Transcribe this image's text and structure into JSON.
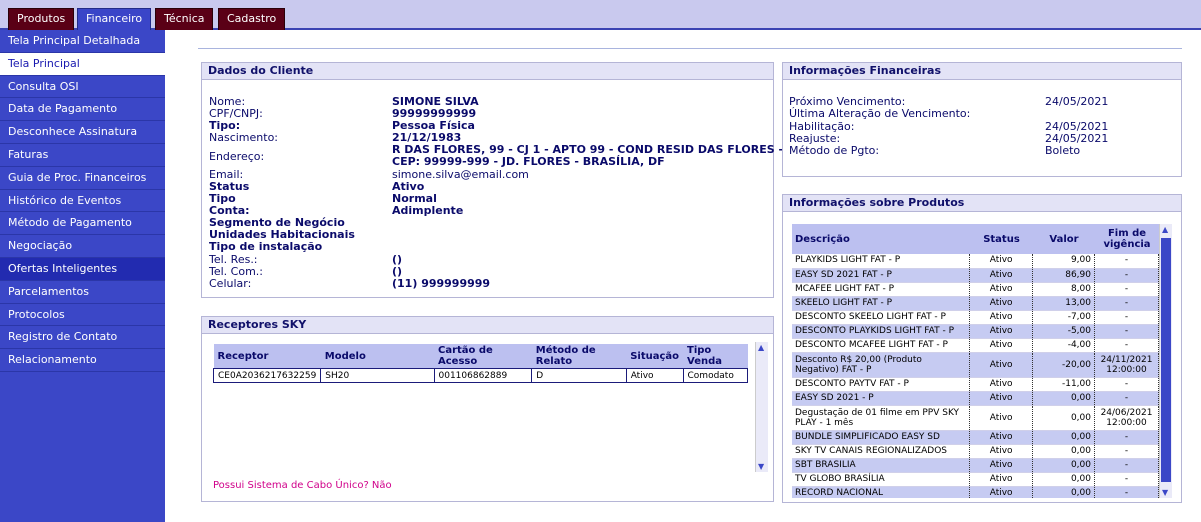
{
  "top_tabs": [
    {
      "label": "Produtos"
    },
    {
      "label": "Financeiro"
    },
    {
      "label": "Técnica"
    },
    {
      "label": "Cadastro"
    }
  ],
  "sidebar": {
    "items": [
      {
        "label": "Tela Principal Detalhada"
      },
      {
        "label": "Tela Principal"
      },
      {
        "label": "Consulta OSI"
      },
      {
        "label": "Data de Pagamento"
      },
      {
        "label": "Desconhece Assinatura"
      },
      {
        "label": "Faturas"
      },
      {
        "label": "Guia de Proc. Financeiros"
      },
      {
        "label": "Histórico de Eventos"
      },
      {
        "label": "Método de Pagamento"
      },
      {
        "label": "Negociação"
      },
      {
        "label": "Ofertas Inteligentes"
      },
      {
        "label": "Parcelamentos"
      },
      {
        "label": "Protocolos"
      },
      {
        "label": "Registro de Contato"
      },
      {
        "label": "Relacionamento"
      }
    ]
  },
  "cliente": {
    "title": "Dados do Cliente",
    "rows": [
      {
        "label": "Nome:",
        "value": "SIMONE SILVA"
      },
      {
        "label": "CPF/CNPJ:",
        "value": "99999999999"
      },
      {
        "label": "Tipo:",
        "value": "Pessoa Física"
      },
      {
        "label": "Nascimento:",
        "value": "21/12/1983"
      },
      {
        "label": "Endereço:",
        "value": "R DAS FLORES, 99 - CJ 1 - APTO 99 - COND RESID DAS FLORES -",
        "value2": "CEP: 99999-999 - JD. FLORES - BRASÍLIA, DF"
      },
      {
        "label": "Email:",
        "value": "simone.silva@email.com"
      },
      {
        "label": "Status",
        "value": "Ativo"
      },
      {
        "label": "Tipo",
        "value": "Normal"
      },
      {
        "label": "Conta:",
        "value": "Adimplente"
      },
      {
        "label": "Segmento de Negócio",
        "value": ""
      },
      {
        "label": "Unidades Habitacionais",
        "value": ""
      },
      {
        "label": "Tipo de instalação",
        "value": ""
      },
      {
        "label": "Tel. Res.:",
        "value": "()"
      },
      {
        "label": "Tel. Com.:",
        "value": "()"
      },
      {
        "label": "Celular:",
        "value": "(11) 999999999"
      }
    ]
  },
  "financeiras": {
    "title": "Informações Financeiras",
    "rows": [
      {
        "label": "Próximo Vencimento:",
        "value": "24/05/2021"
      },
      {
        "label": "Última Alteração de Vencimento:",
        "value": ""
      },
      {
        "label": "Habilitação:",
        "value": "24/05/2021"
      },
      {
        "label": "Reajuste:",
        "value": "24/05/2021"
      },
      {
        "label": "Método de Pgto:",
        "value": "Boleto"
      }
    ]
  },
  "receptores": {
    "title": "Receptores SKY",
    "headers": [
      "Receptor",
      "Modelo",
      "Cartão de Acesso",
      "Método de Relato",
      "Situação",
      "Tipo Venda"
    ],
    "rows": [
      [
        "CE0A2036217632259",
        "SH20",
        "001106862889",
        "D",
        "Ativo",
        "Comodato"
      ]
    ],
    "footer": "Possui Sistema de Cabo Único? Não"
  },
  "produtos": {
    "title": "Informações sobre Produtos",
    "headers": [
      "Descrição",
      "Status",
      "Valor",
      "Fim de vigência"
    ],
    "rows": [
      [
        "PLAYKIDS LIGHT FAT - P",
        "Ativo",
        "9,00",
        "-"
      ],
      [
        "EASY SD 2021 FAT - P",
        "Ativo",
        "86,90",
        "-"
      ],
      [
        "MCAFEE LIGHT FAT - P",
        "Ativo",
        "8,00",
        "-"
      ],
      [
        "SKEELO LIGHT FAT - P",
        "Ativo",
        "13,00",
        "-"
      ],
      [
        "DESCONTO SKEELO LIGHT FAT - P",
        "Ativo",
        "-7,00",
        "-"
      ],
      [
        "DESCONTO PLAYKIDS LIGHT FAT - P",
        "Ativo",
        "-5,00",
        "-"
      ],
      [
        "DESCONTO MCAFEE LIGHT FAT - P",
        "Ativo",
        "-4,00",
        "-"
      ],
      [
        "Desconto R$ 20,00 (Produto Negativo) FAT - P",
        "Ativo",
        "-20,00",
        "24/11/2021 12:00:00"
      ],
      [
        "DESCONTO PAYTV FAT - P",
        "Ativo",
        "-11,00",
        "-"
      ],
      [
        "EASY SD 2021 - P",
        "Ativo",
        "0,00",
        "-"
      ],
      [
        "Degustação de 01 filme em PPV SKY PLAY - 1 mês",
        "Ativo",
        "0,00",
        "24/06/2021 12:00:00"
      ],
      [
        "BUNDLE SIMPLIFICADO EASY SD",
        "Ativo",
        "0,00",
        "-"
      ],
      [
        "SKY TV CANAIS REGIONALIZADOS",
        "Ativo",
        "0,00",
        "-"
      ],
      [
        "SBT BRASILIA",
        "Ativo",
        "0,00",
        "-"
      ],
      [
        "TV GLOBO BRASÍLIA",
        "Ativo",
        "0,00",
        "-"
      ],
      [
        "RECORD NACIONAL",
        "Ativo",
        "0,00",
        "-"
      ]
    ]
  }
}
